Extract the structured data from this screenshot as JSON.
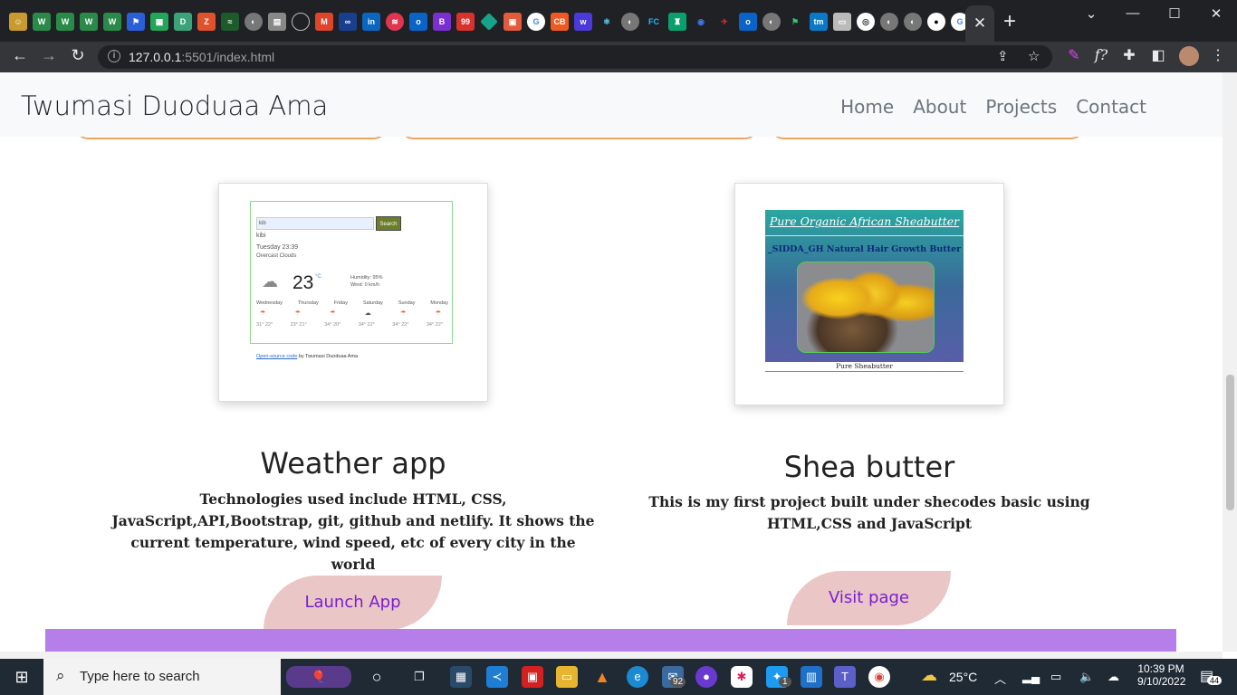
{
  "browser": {
    "url_host": "127.0.0.1",
    "url_rest": ":5501/index.html",
    "active_tab_close": "✕",
    "new_tab": "+"
  },
  "site": {
    "brand": "Twumasi Duoduaa Ama",
    "nav": [
      "Home",
      "About",
      "Projects",
      "Contact"
    ]
  },
  "projects": [
    {
      "title": "Weather app",
      "description": "Technologies used include HTML, CSS, JavaScript,API,Bootstrap, git, github and netlify. It shows the current temperature, wind speed, etc of every city in the world",
      "button": "Launch App"
    },
    {
      "title": "Shea butter",
      "description": "This is my first project built under shecodes basic using HTML,CSS and JavaScript",
      "button": "Visit page"
    }
  ],
  "weather_preview": {
    "input": "kib",
    "search": "Search",
    "city": "kibi",
    "datetime": "Tuesday 23:39",
    "condition": "Overcast Clouds",
    "temp": "23",
    "unit": "°C",
    "humidity": "Humidity: 95%",
    "wind": "Wind: 0 km/h",
    "days": [
      "Wednesday",
      "Thursday",
      "Friday",
      "Saturday",
      "Sunday",
      "Monday"
    ],
    "temps": [
      "31° 22°",
      "23° 21°",
      "34° 20°",
      "34° 22°",
      "34° 22°",
      "34° 22°"
    ],
    "footer_link": "Open-source code",
    "footer_text": "by Twumasi Duoduaa Ama"
  },
  "shea_preview": {
    "heading": "Pure Organic African Sheabutter",
    "subheading": "_SIDDA_GH Natural Hair Growth Butter",
    "caption": "Pure Sheabutter"
  },
  "taskbar": {
    "search_placeholder": "Type here to search",
    "weather": "25°C",
    "time": "10:39 PM",
    "date": "9/10/2022",
    "notifications": "44",
    "mail_badge": "92",
    "twitter_badge": "1"
  }
}
